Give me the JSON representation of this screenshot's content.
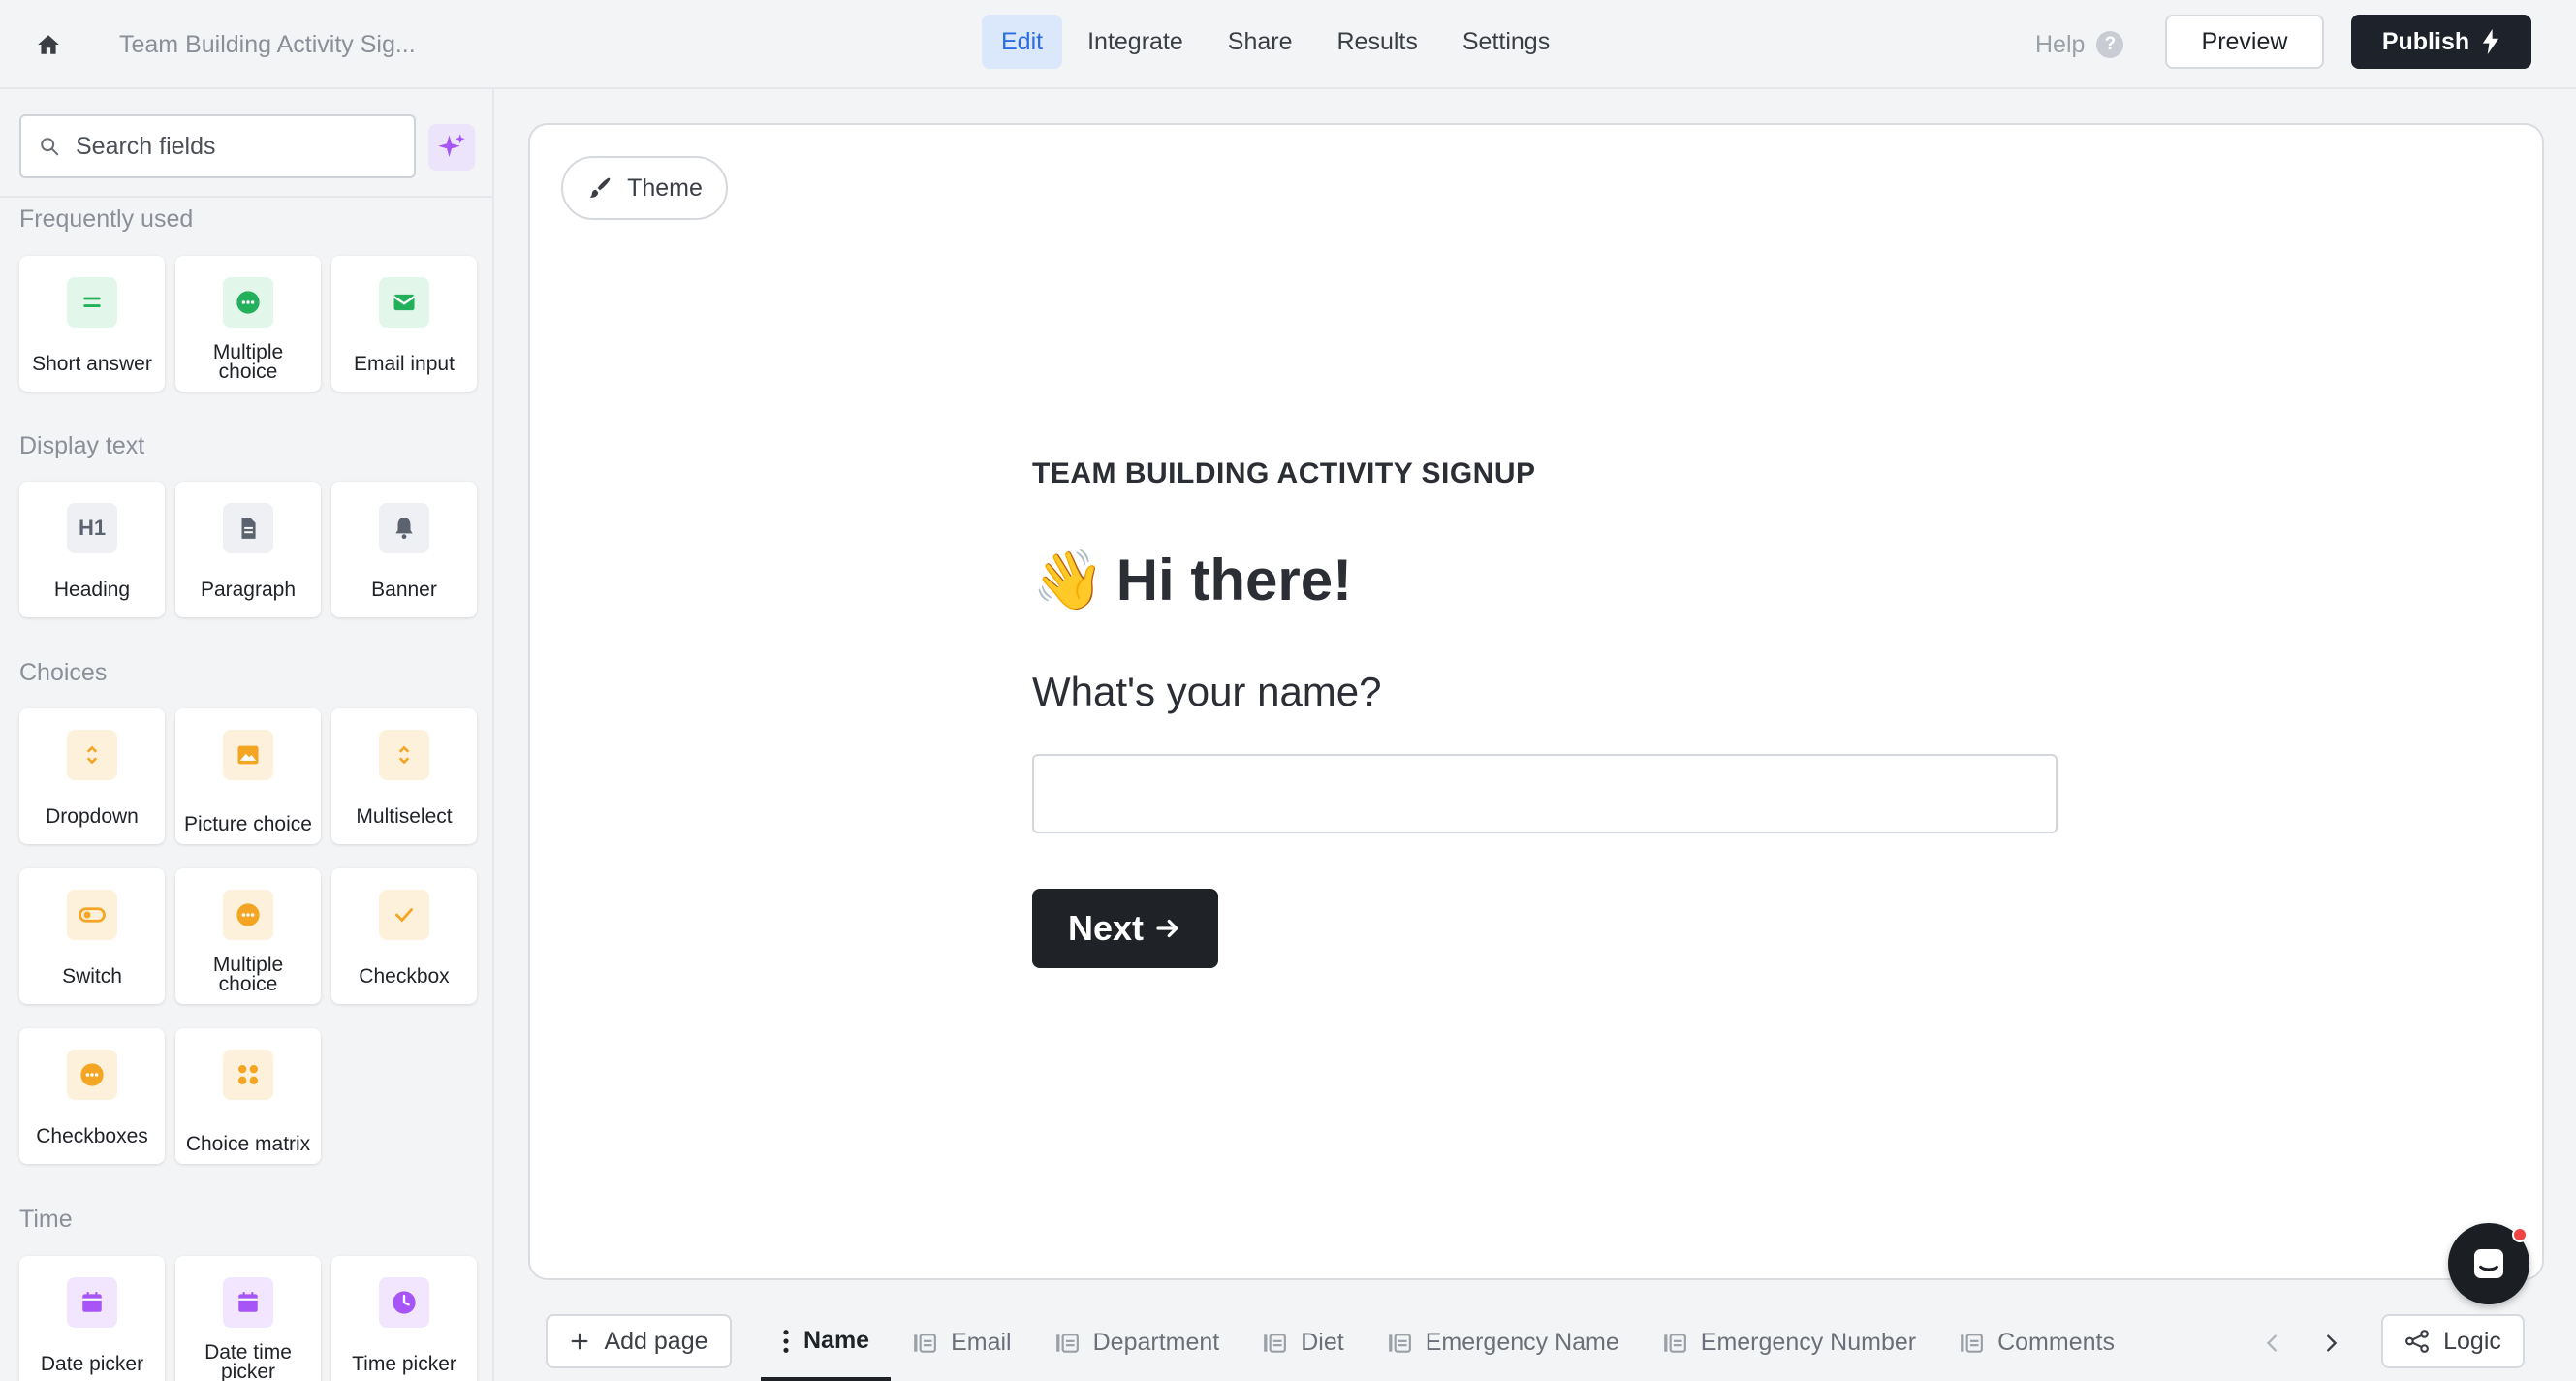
{
  "header": {
    "doc_title": "Team Building Activity Sig...",
    "nav": [
      "Edit",
      "Integrate",
      "Share",
      "Results",
      "Settings"
    ],
    "help_label": "Help",
    "help_icon_text": "?",
    "preview_label": "Preview",
    "publish_label": "Publish"
  },
  "sidebar": {
    "search_placeholder": "Search fields",
    "sections": {
      "frequent": {
        "title": "Frequently used",
        "items": [
          "Short answer",
          "Multiple choice",
          "Email input"
        ]
      },
      "display": {
        "title": "Display text",
        "items": [
          "Heading",
          "Paragraph",
          "Banner"
        ]
      },
      "choices": {
        "title": "Choices",
        "items": [
          "Dropdown",
          "Picture choice",
          "Multiselect",
          "Switch",
          "Multiple choice",
          "Checkbox",
          "Checkboxes",
          "Choice matrix"
        ]
      },
      "time": {
        "title": "Time",
        "items": [
          "Date picker",
          "Date time picker",
          "Time picker"
        ]
      }
    },
    "heading_icon_text": "H1"
  },
  "canvas": {
    "theme_label": "Theme",
    "eyebrow": "TEAM BUILDING ACTIVITY SIGNUP",
    "wave_emoji": "👋",
    "hello": "Hi there!",
    "question": "What's your name?",
    "answer_value": "",
    "next_label": "Next"
  },
  "footer": {
    "add_page_label": "Add page",
    "pages": [
      "Name",
      "Email",
      "Department",
      "Diet",
      "Emergency Name",
      "Emergency Number",
      "Comments"
    ],
    "active_page": "Name",
    "logic_label": "Logic"
  },
  "colors": {
    "accent": "#2a6de0",
    "publish_bg": "#1e222a",
    "green_icon": "#22b05a",
    "orange_icon": "#f5a524",
    "purple_icon": "#a855f7"
  }
}
